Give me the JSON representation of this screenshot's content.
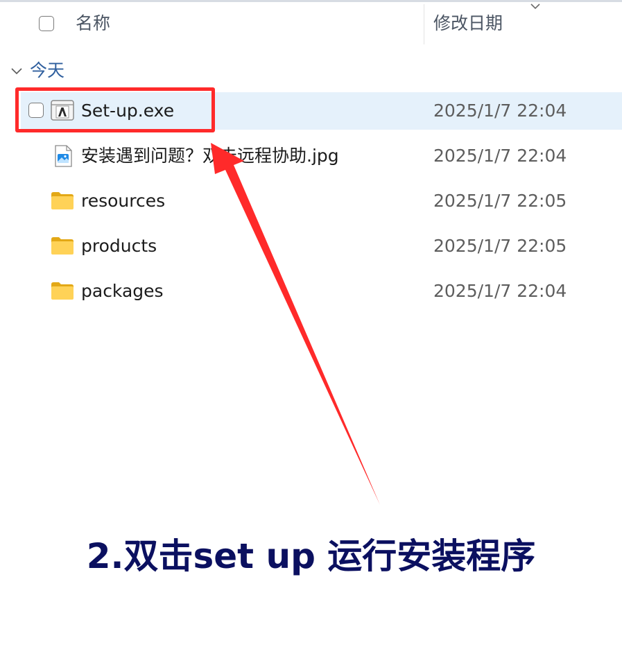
{
  "header": {
    "name_label": "名称",
    "date_label": "修改日期"
  },
  "group": {
    "label": "今天"
  },
  "files": [
    {
      "name": "Set-up.exe",
      "date": "2025/1/7 22:04",
      "icon": "adobe-exe-icon",
      "selected": true
    },
    {
      "name": "安装遇到问题？双击远程协助.jpg",
      "date": "2025/1/7 22:04",
      "icon": "image-file-icon",
      "selected": false
    },
    {
      "name": "resources",
      "date": "2025/1/7 22:05",
      "icon": "folder-icon",
      "selected": false
    },
    {
      "name": "products",
      "date": "2025/1/7 22:05",
      "icon": "folder-icon",
      "selected": false
    },
    {
      "name": "packages",
      "date": "2025/1/7 22:04",
      "icon": "folder-icon",
      "selected": false
    }
  ],
  "annotation": {
    "caption": "2.双击set up 运行安装程序",
    "highlight_color": "#ff2a2a",
    "caption_color": "#0b1060"
  },
  "colors": {
    "selected_row": "#e5f1fb",
    "group_label": "#2f5f9e"
  }
}
